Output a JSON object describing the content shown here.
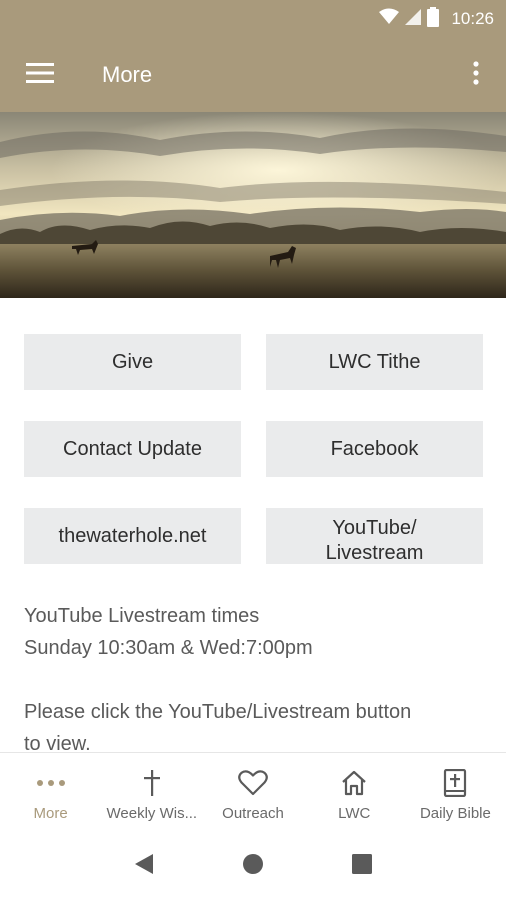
{
  "status_bar": {
    "time": "10:26",
    "icons": [
      "wifi-icon",
      "cell-signal-icon",
      "battery-icon"
    ]
  },
  "app_bar": {
    "title": "More",
    "menu_icon": "hamburger-menu-icon",
    "overflow_icon": "more-vertical-icon"
  },
  "hero": {
    "image": "sunrise-pasture-with-horses"
  },
  "tiles": [
    {
      "label": "Give"
    },
    {
      "label": "LWC Tithe"
    },
    {
      "label": "Contact Update"
    },
    {
      "label": "Facebook"
    },
    {
      "label": "thewaterhole.net"
    },
    {
      "label": "YouTube/ Livestream"
    }
  ],
  "info": {
    "line1": "YouTube Livestream times",
    "line2": "Sunday 10:30am &  Wed:7:00pm",
    "line3": "Please click the YouTube/Livestream button",
    "line4": "to view."
  },
  "bottom_nav": [
    {
      "label": "More",
      "icon": "more-dots-icon",
      "active": true
    },
    {
      "label": "Weekly Wis...",
      "icon": "cross-icon",
      "active": false
    },
    {
      "label": "Outreach",
      "icon": "heart-icon",
      "active": false
    },
    {
      "label": "LWC",
      "icon": "home-icon",
      "active": false
    },
    {
      "label": "Daily Bible",
      "icon": "bible-icon",
      "active": false
    }
  ],
  "colors": {
    "brand": "#a99a7c",
    "tile_bg": "#eaebec"
  }
}
